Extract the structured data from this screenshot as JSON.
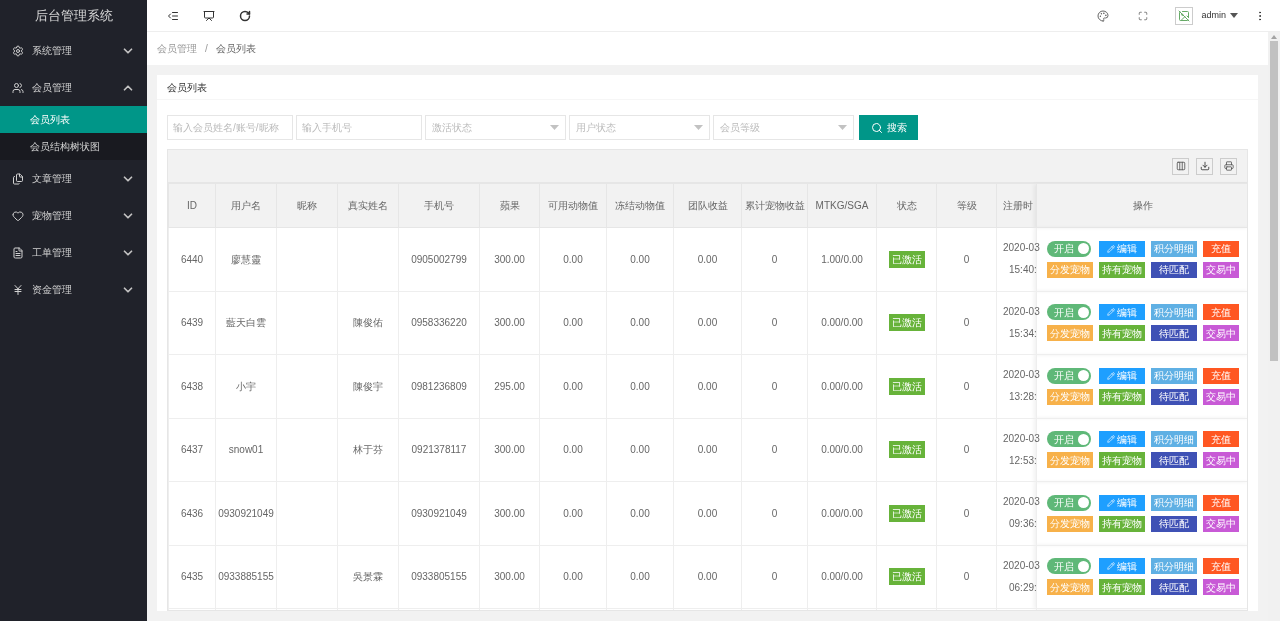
{
  "app_title": "后台管理系统",
  "sidebar": {
    "items": [
      {
        "label": "系统管理",
        "expanded": false
      },
      {
        "label": "会员管理",
        "expanded": true,
        "children": [
          {
            "label": "会员列表",
            "selected": true
          },
          {
            "label": "会员结构树状图",
            "selected": false
          }
        ]
      },
      {
        "label": "文章管理",
        "expanded": false
      },
      {
        "label": "宠物管理",
        "expanded": false
      },
      {
        "label": "工单管理",
        "expanded": false
      },
      {
        "label": "资金管理",
        "expanded": false
      }
    ]
  },
  "header": {
    "user": "admin"
  },
  "breadcrumb": [
    "会员管理",
    "会员列表"
  ],
  "breadcrumb_separator": "/",
  "card_title": "会员列表",
  "filters": [
    {
      "kind": "input",
      "placeholder": "输入会员姓名/账号/昵称"
    },
    {
      "kind": "input",
      "placeholder": "输入手机号"
    },
    {
      "kind": "select",
      "placeholder": "激活状态"
    },
    {
      "kind": "select",
      "placeholder": "用户状态"
    },
    {
      "kind": "select",
      "placeholder": "会员等级"
    }
  ],
  "search_button": "搜索",
  "table": {
    "columns": [
      "ID",
      "用户名",
      "昵称",
      "真实姓名",
      "手机号",
      "蘋果",
      "可用动物值",
      "冻结动物值",
      "团队收益",
      "累计宠物收益",
      "MTKG/SGA",
      "状态",
      "等级",
      "注册时",
      "操作"
    ],
    "rows": [
      {
        "cells": [
          "6440",
          "廖慧靈",
          "",
          "",
          "0905002799",
          "300.00",
          "0.00",
          "0.00",
          "0.00",
          "0",
          "1.00/0.00"
        ],
        "status": {
          "label": "已激活",
          "kind": "active"
        },
        "level": "0",
        "reg": [
          "2020-03",
          "15:40:"
        ],
        "switch": {
          "label": "开启",
          "on": true
        },
        "actions": [
          {
            "label": "编辑",
            "color": "#1e9fff"
          },
          {
            "label": "积分明细",
            "color": "#5fb0e4"
          },
          {
            "label": "充值",
            "color": "#ff5722"
          },
          {
            "label": "分发宠物",
            "color": "#f7b14a"
          },
          {
            "label": "持有宠物",
            "color": "#67b33a"
          },
          {
            "label": "待匹配",
            "color": "#3f51b5"
          },
          {
            "label": "交易中",
            "color": "#c85ad6"
          }
        ]
      },
      {
        "cells": [
          "6439",
          "藍天白雲",
          "",
          "陳俊佑",
          "0958336220",
          "300.00",
          "0.00",
          "0.00",
          "0.00",
          "0",
          "0.00/0.00"
        ],
        "status": {
          "label": "已激活",
          "kind": "active"
        },
        "level": "0",
        "reg": [
          "2020-03",
          "15:34:"
        ],
        "switch": {
          "label": "开启",
          "on": true
        },
        "actions": [
          {
            "label": "编辑",
            "color": "#1e9fff"
          },
          {
            "label": "积分明细",
            "color": "#5fb0e4"
          },
          {
            "label": "充值",
            "color": "#ff5722"
          },
          {
            "label": "分发宠物",
            "color": "#f7b14a"
          },
          {
            "label": "持有宠物",
            "color": "#67b33a"
          },
          {
            "label": "待匹配",
            "color": "#3f51b5"
          },
          {
            "label": "交易中",
            "color": "#c85ad6"
          }
        ]
      },
      {
        "cells": [
          "6438",
          "小宇",
          "",
          "陳俊宇",
          "0981236809",
          "295.00",
          "0.00",
          "0.00",
          "0.00",
          "0",
          "0.00/0.00"
        ],
        "status": {
          "label": "已激活",
          "kind": "active"
        },
        "level": "0",
        "reg": [
          "2020-03",
          "13:28:"
        ],
        "switch": {
          "label": "开启",
          "on": true
        },
        "actions": [
          {
            "label": "编辑",
            "color": "#1e9fff"
          },
          {
            "label": "积分明细",
            "color": "#5fb0e4"
          },
          {
            "label": "充值",
            "color": "#ff5722"
          },
          {
            "label": "分发宠物",
            "color": "#f7b14a"
          },
          {
            "label": "持有宠物",
            "color": "#67b33a"
          },
          {
            "label": "待匹配",
            "color": "#3f51b5"
          },
          {
            "label": "交易中",
            "color": "#c85ad6"
          }
        ]
      },
      {
        "cells": [
          "6437",
          "snow01",
          "",
          "林于芬",
          "0921378117",
          "300.00",
          "0.00",
          "0.00",
          "0.00",
          "0",
          "0.00/0.00"
        ],
        "status": {
          "label": "已激活",
          "kind": "active"
        },
        "level": "0",
        "reg": [
          "2020-03",
          "12:53:"
        ],
        "switch": {
          "label": "开启",
          "on": true
        },
        "actions": [
          {
            "label": "编辑",
            "color": "#1e9fff"
          },
          {
            "label": "积分明细",
            "color": "#5fb0e4"
          },
          {
            "label": "充值",
            "color": "#ff5722"
          },
          {
            "label": "分发宠物",
            "color": "#f7b14a"
          },
          {
            "label": "持有宠物",
            "color": "#67b33a"
          },
          {
            "label": "待匹配",
            "color": "#3f51b5"
          },
          {
            "label": "交易中",
            "color": "#c85ad6"
          }
        ]
      },
      {
        "cells": [
          "6436",
          "0930921049",
          "",
          "",
          "0930921049",
          "300.00",
          "0.00",
          "0.00",
          "0.00",
          "0",
          "0.00/0.00"
        ],
        "status": {
          "label": "已激活",
          "kind": "active"
        },
        "level": "0",
        "reg": [
          "2020-03",
          "09:36:"
        ],
        "switch": {
          "label": "开启",
          "on": true
        },
        "actions": [
          {
            "label": "编辑",
            "color": "#1e9fff"
          },
          {
            "label": "积分明细",
            "color": "#5fb0e4"
          },
          {
            "label": "充值",
            "color": "#ff5722"
          },
          {
            "label": "分发宠物",
            "color": "#f7b14a"
          },
          {
            "label": "持有宠物",
            "color": "#67b33a"
          },
          {
            "label": "待匹配",
            "color": "#3f51b5"
          },
          {
            "label": "交易中",
            "color": "#c85ad6"
          }
        ]
      },
      {
        "cells": [
          "6435",
          "0933885155",
          "",
          "吳景霖",
          "0933805155",
          "300.00",
          "0.00",
          "0.00",
          "0.00",
          "0",
          "0.00/0.00"
        ],
        "status": {
          "label": "已激活",
          "kind": "active"
        },
        "level": "0",
        "reg": [
          "2020-03",
          "06:29:"
        ],
        "switch": {
          "label": "开启",
          "on": true
        },
        "actions": [
          {
            "label": "编辑",
            "color": "#1e9fff"
          },
          {
            "label": "积分明细",
            "color": "#5fb0e4"
          },
          {
            "label": "充值",
            "color": "#ff5722"
          },
          {
            "label": "分发宠物",
            "color": "#f7b14a"
          },
          {
            "label": "持有宠物",
            "color": "#67b33a"
          },
          {
            "label": "待匹配",
            "color": "#3f51b5"
          },
          {
            "label": "交易中",
            "color": "#c85ad6"
          }
        ]
      }
    ]
  }
}
